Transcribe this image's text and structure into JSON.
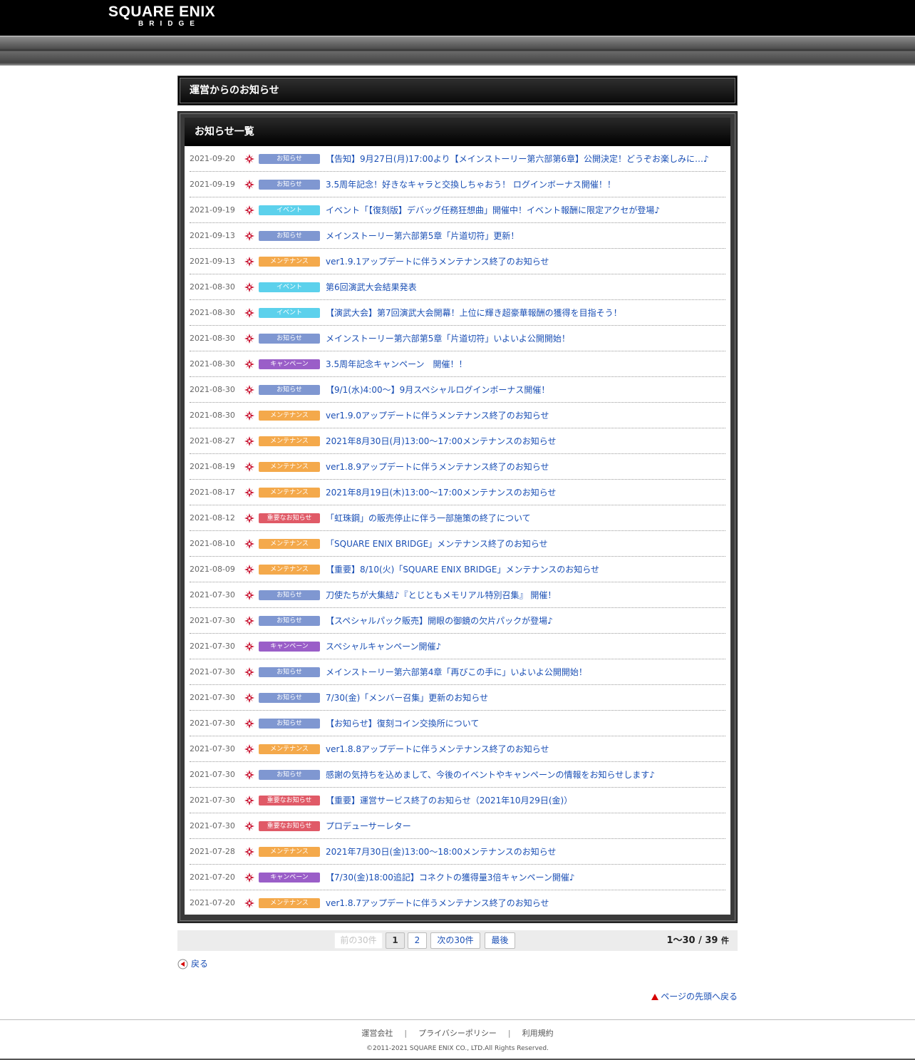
{
  "header": {
    "logo_line1": "SQUARE ENIX",
    "logo_line2": "BRIDGE"
  },
  "page_title": "運営からのお知らせ",
  "list_title": "お知らせ一覧",
  "colors": {
    "お知らせ": "#7f97d1",
    "イベント": "#5cd1ec",
    "メンテナンス": "#f4a94b",
    "キャンペーン": "#9a5ec8",
    "重要なお知らせ": "#e05a67",
    "link": "#1a4fb5",
    "mark": "#c8102e"
  },
  "items": [
    {
      "date": "2021-09-20",
      "category": "お知らせ",
      "title": "【告知】9月27日(月)17:00より【メインストーリー第六部第6章】公開決定！どうぞお楽しみに…♪"
    },
    {
      "date": "2021-09-19",
      "category": "お知らせ",
      "title": "3.5周年記念！好きなキャラと交換しちゃおう！ ログインボーナス開催！！"
    },
    {
      "date": "2021-09-19",
      "category": "イベント",
      "title": "イベント「【復刻版】デバッグ任務狂想曲」開催中！イベント報酬に限定アクセが登場♪"
    },
    {
      "date": "2021-09-13",
      "category": "お知らせ",
      "title": "メインストーリー第六部第5章「片道切符」更新！"
    },
    {
      "date": "2021-09-13",
      "category": "メンテナンス",
      "title": "ver1.9.1アップデートに伴うメンテナンス終了のお知らせ"
    },
    {
      "date": "2021-08-30",
      "category": "イベント",
      "title": "第6回演武大会結果発表"
    },
    {
      "date": "2021-08-30",
      "category": "イベント",
      "title": "【演武大会】第7回演武大会開幕！上位に輝き超豪華報酬の獲得を目指そう！"
    },
    {
      "date": "2021-08-30",
      "category": "お知らせ",
      "title": "メインストーリー第六部第5章「片道切符」いよいよ公開開始！"
    },
    {
      "date": "2021-08-30",
      "category": "キャンペーン",
      "title": "3.5周年記念キャンペーン　開催！！"
    },
    {
      "date": "2021-08-30",
      "category": "お知らせ",
      "title": "【9/1(水)4:00～】9月スペシャルログインボーナス開催！"
    },
    {
      "date": "2021-08-30",
      "category": "メンテナンス",
      "title": "ver1.9.0アップデートに伴うメンテナンス終了のお知らせ"
    },
    {
      "date": "2021-08-27",
      "category": "メンテナンス",
      "title": "2021年8月30日(月)13:00～17:00メンテナンスのお知らせ"
    },
    {
      "date": "2021-08-19",
      "category": "メンテナンス",
      "title": "ver1.8.9アップデートに伴うメンテナンス終了のお知らせ"
    },
    {
      "date": "2021-08-17",
      "category": "メンテナンス",
      "title": "2021年8月19日(木)13:00～17:00メンテナンスのお知らせ"
    },
    {
      "date": "2021-08-12",
      "category": "重要なお知らせ",
      "title": "「虹珠鋼」の販売停止に伴う一部施策の終了について"
    },
    {
      "date": "2021-08-10",
      "category": "メンテナンス",
      "title": "「SQUARE ENIX BRIDGE」メンテナンス終了のお知らせ"
    },
    {
      "date": "2021-08-09",
      "category": "メンテナンス",
      "title": "【重要】8/10(火)「SQUARE ENIX BRIDGE」メンテナンスのお知らせ"
    },
    {
      "date": "2021-07-30",
      "category": "お知らせ",
      "title": "刀使たちが大集結♪『とじともメモリアル特別召集』 開催！"
    },
    {
      "date": "2021-07-30",
      "category": "お知らせ",
      "title": "【スペシャルパック販売】開眼の御鏡の欠片パックが登場♪"
    },
    {
      "date": "2021-07-30",
      "category": "キャンペーン",
      "title": "スペシャルキャンペーン開催♪"
    },
    {
      "date": "2021-07-30",
      "category": "お知らせ",
      "title": "メインストーリー第六部第4章「再びこの手に」いよいよ公開開始！"
    },
    {
      "date": "2021-07-30",
      "category": "お知らせ",
      "title": "7/30(金)「メンバー召集」更新のお知らせ"
    },
    {
      "date": "2021-07-30",
      "category": "お知らせ",
      "title": "【お知らせ】復刻コイン交換所について"
    },
    {
      "date": "2021-07-30",
      "category": "メンテナンス",
      "title": "ver1.8.8アップデートに伴うメンテナンス終了のお知らせ"
    },
    {
      "date": "2021-07-30",
      "category": "お知らせ",
      "title": "感謝の気持ちを込めまして、今後のイベントやキャンペーンの情報をお知らせします♪"
    },
    {
      "date": "2021-07-30",
      "category": "重要なお知らせ",
      "title": "【重要】運営サービス終了のお知らせ（2021年10月29日(金)）"
    },
    {
      "date": "2021-07-30",
      "category": "重要なお知らせ",
      "title": "プロデューサーレター"
    },
    {
      "date": "2021-07-28",
      "category": "メンテナンス",
      "title": "2021年7月30日(金)13:00～18:00メンテナンスのお知らせ"
    },
    {
      "date": "2021-07-20",
      "category": "キャンペーン",
      "title": "【7/30(金)18:00追記】コネクトの獲得量3倍キャンペーン開催♪"
    },
    {
      "date": "2021-07-20",
      "category": "メンテナンス",
      "title": "ver1.8.7アップデートに伴うメンテナンス終了のお知らせ"
    }
  ],
  "pager": {
    "prev": "前の30件",
    "pages": [
      "1",
      "2"
    ],
    "current": "1",
    "next": "次の30件",
    "last": "最後",
    "range": "1〜30 / 39",
    "unit": "件"
  },
  "back_label": "戻る",
  "to_top_label": "ページの先頭へ戻る",
  "footer": {
    "links": [
      "運営会社",
      "プライバシーポリシー",
      "利用規約"
    ],
    "separator": "|",
    "copyright": "©2011-2021 SQUARE ENIX CO., LTD.All Rights Reserved."
  }
}
